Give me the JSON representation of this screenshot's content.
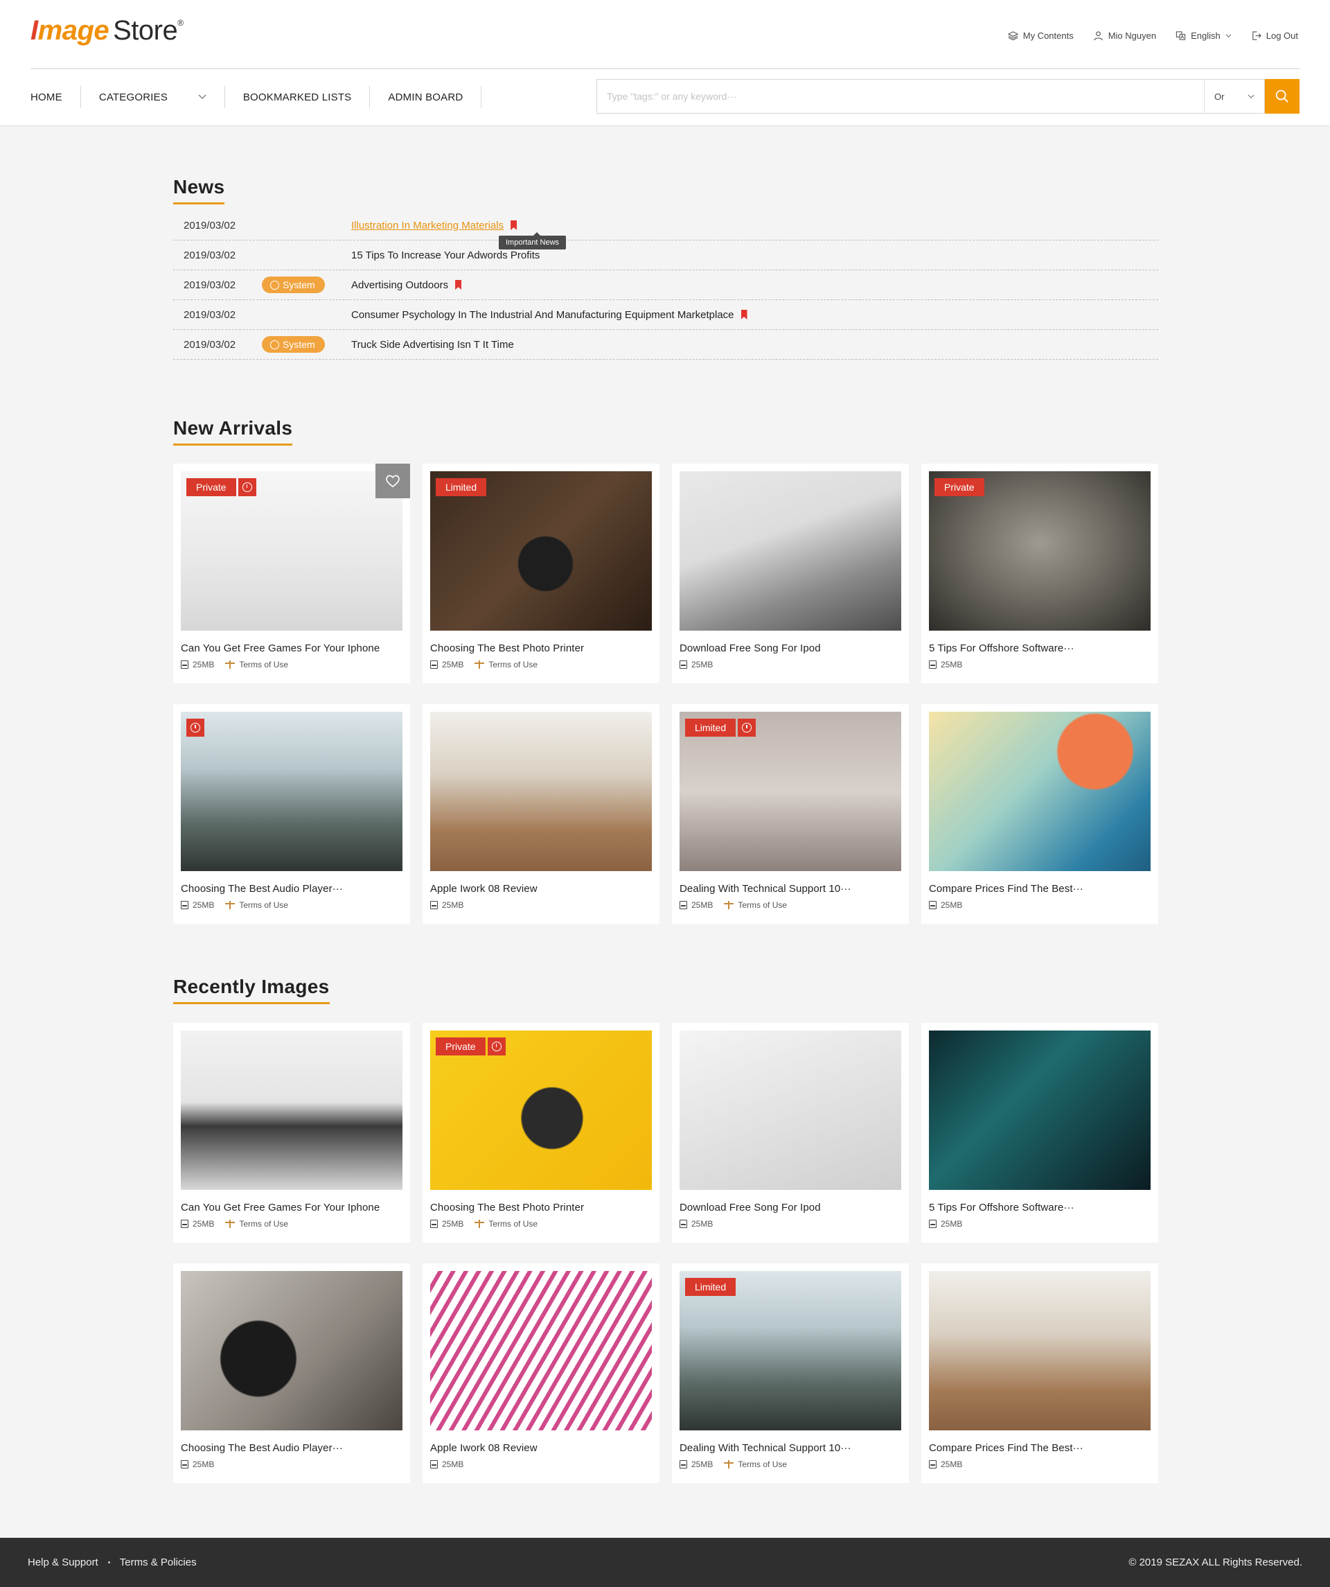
{
  "brand": {
    "logo_part1": "I",
    "logo_part2": "mage",
    "logo_part3": "Store",
    "logo_mark": "®"
  },
  "header": {
    "links": [
      {
        "label": "My Contents",
        "icon": "layers-icon"
      },
      {
        "label": "Mio Nguyen",
        "icon": "user-icon"
      },
      {
        "label": "English",
        "icon": "language-icon"
      },
      {
        "label": "Log Out",
        "icon": "logout-icon"
      }
    ],
    "nav": [
      "HOME",
      "CATEGORIES",
      "BOOKMARKED LISTS",
      "ADMIN BOARD"
    ],
    "search": {
      "placeholder": "Type \"tags:\" or any keyword···",
      "mode": "Or"
    }
  },
  "colors": {
    "accent": "#f39800",
    "tag_red": "#d9392b",
    "link_orange": "#e8920f",
    "footer_bg": "#2f2f2f"
  },
  "news": {
    "title": "News",
    "tooltip": "Important News",
    "items": [
      {
        "date": "2019/03/02",
        "badge": "",
        "title": "Illustration In Marketing Materials",
        "bookmark": true,
        "link": true
      },
      {
        "date": "2019/03/02",
        "badge": "",
        "title": "15 Tips To Increase Your Adwords Profits",
        "bookmark": false,
        "link": false
      },
      {
        "date": "2019/03/02",
        "badge": "System",
        "title": "Advertising Outdoors",
        "bookmark": true,
        "link": false
      },
      {
        "date": "2019/03/02",
        "badge": "",
        "title": "Consumer Psychology In The Industrial And Manufacturing Equipment Marketplace",
        "bookmark": true,
        "link": false
      },
      {
        "date": "2019/03/02",
        "badge": "System",
        "title": "Truck Side Advertising Isn T It Time",
        "bookmark": false,
        "link": false
      }
    ]
  },
  "new_arrivals": {
    "title": "New Arrivals",
    "items": [
      {
        "title": "Can You Get Free Games For Your Iphone",
        "size": "25MB",
        "terms": "Terms of Use",
        "tag": "Private",
        "clock": true,
        "fav": true,
        "img": "laptop"
      },
      {
        "title": "Choosing The Best Photo Printer",
        "size": "25MB",
        "terms": "Terms of Use",
        "tag": "Limited",
        "clock": false,
        "fav": false,
        "img": "wood"
      },
      {
        "title": "Download Free Song For Ipod",
        "size": "25MB",
        "terms": "",
        "tag": "",
        "clock": false,
        "fav": false,
        "img": "desk"
      },
      {
        "title": "5 Tips For Offshore Software···",
        "size": "25MB",
        "terms": "",
        "tag": "Private",
        "clock": false,
        "fav": false,
        "img": "paper"
      },
      {
        "title": "Choosing The Best Audio Player···",
        "size": "25MB",
        "terms": "Terms of Use",
        "tag": "",
        "clock": true,
        "fav": false,
        "img": "forest"
      },
      {
        "title": "Apple Iwork 08 Review",
        "size": "25MB",
        "terms": "",
        "tag": "",
        "clock": false,
        "fav": false,
        "img": "table"
      },
      {
        "title": "Dealing With Technical Support 10···",
        "size": "25MB",
        "terms": "Terms of Use",
        "tag": "Limited",
        "clock": true,
        "fav": false,
        "img": "records"
      },
      {
        "title": "Compare Prices Find The Best···",
        "size": "25MB",
        "terms": "",
        "tag": "",
        "clock": false,
        "fav": false,
        "img": "art"
      }
    ]
  },
  "recent": {
    "title": "Recently Images",
    "items": [
      {
        "title": "Can You Get Free Games For Your Iphone",
        "size": "25MB",
        "terms": "Terms of Use",
        "tag": "",
        "clock": false,
        "fav": false,
        "img": "dog"
      },
      {
        "title": "Choosing The Best Photo Printer",
        "size": "25MB",
        "terms": "Terms of Use",
        "tag": "Private",
        "clock": true,
        "fav": false,
        "img": "headphones"
      },
      {
        "title": "Download Free Song For Ipod",
        "size": "25MB",
        "terms": "",
        "tag": "",
        "clock": false,
        "fav": false,
        "img": "coffee"
      },
      {
        "title": "5 Tips For Offshore Software···",
        "size": "25MB",
        "terms": "",
        "tag": "",
        "clock": false,
        "fav": false,
        "img": "concert"
      },
      {
        "title": "Choosing The Best Audio Player···",
        "size": "25MB",
        "terms": "",
        "tag": "",
        "clock": false,
        "fav": false,
        "img": "camera"
      },
      {
        "title": "Apple Iwork 08 Review",
        "size": "25MB",
        "terms": "",
        "tag": "",
        "clock": false,
        "fav": false,
        "img": "stripes"
      },
      {
        "title": "Dealing With Technical Support 10···",
        "size": "25MB",
        "terms": "Terms of Use",
        "tag": "Limited",
        "clock": false,
        "fav": false,
        "img": "forest"
      },
      {
        "title": "Compare Prices Find The Best···",
        "size": "25MB",
        "terms": "",
        "tag": "",
        "clock": false,
        "fav": false,
        "img": "table"
      }
    ]
  },
  "footer": {
    "links": [
      "Help & Support",
      "Terms & Policies"
    ],
    "copyright": "© 2019 SEZAX ALL Rights Reserved."
  }
}
